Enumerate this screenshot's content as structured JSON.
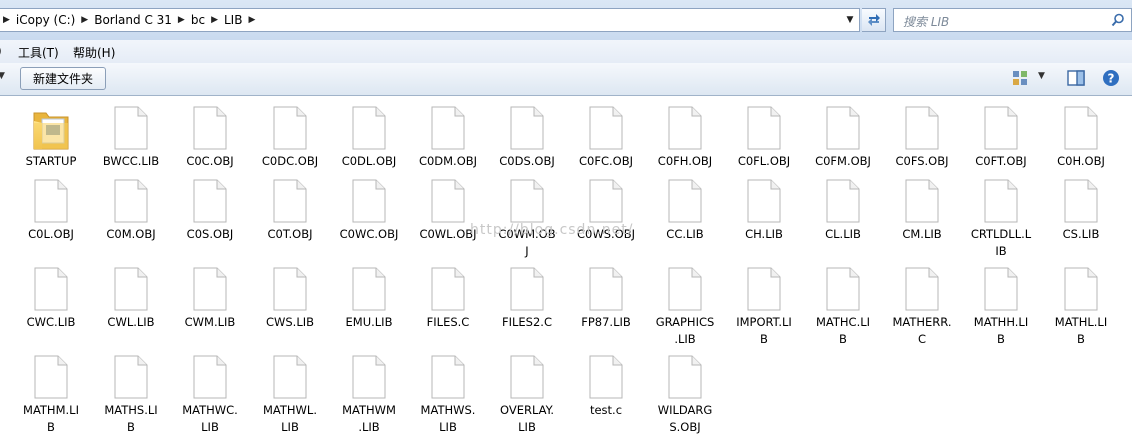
{
  "address": {
    "crumbs": [
      "iCopy (C:)",
      "Borland C 31",
      "bc",
      "LIB"
    ]
  },
  "search": {
    "placeholder": "搜索 LIB"
  },
  "menu": {
    "tools": "工具(T)",
    "help": "帮助(H)"
  },
  "toolbar": {
    "new_folder": "新建文件夹"
  },
  "files": [
    {
      "type": "folder",
      "l1": "STARTUP",
      "l2": ""
    },
    {
      "type": "file",
      "l1": "BWCC.LIB",
      "l2": ""
    },
    {
      "type": "file",
      "l1": "C0C.OBJ",
      "l2": ""
    },
    {
      "type": "file",
      "l1": "C0DC.OBJ",
      "l2": ""
    },
    {
      "type": "file",
      "l1": "C0DL.OBJ",
      "l2": ""
    },
    {
      "type": "file",
      "l1": "C0DM.OBJ",
      "l2": ""
    },
    {
      "type": "file",
      "l1": "C0DS.OBJ",
      "l2": ""
    },
    {
      "type": "file",
      "l1": "C0FC.OBJ",
      "l2": ""
    },
    {
      "type": "file",
      "l1": "C0FH.OBJ",
      "l2": ""
    },
    {
      "type": "file",
      "l1": "C0FL.OBJ",
      "l2": ""
    },
    {
      "type": "file",
      "l1": "C0FM.OBJ",
      "l2": ""
    },
    {
      "type": "file",
      "l1": "C0FS.OBJ",
      "l2": ""
    },
    {
      "type": "file",
      "l1": "C0FT.OBJ",
      "l2": ""
    },
    {
      "type": "file",
      "l1": "C0H.OBJ",
      "l2": ""
    },
    {
      "type": "file",
      "l1": "C0L.OBJ",
      "l2": ""
    },
    {
      "type": "file",
      "l1": "C0M.OBJ",
      "l2": ""
    },
    {
      "type": "file",
      "l1": "C0S.OBJ",
      "l2": ""
    },
    {
      "type": "file",
      "l1": "C0T.OBJ",
      "l2": ""
    },
    {
      "type": "file",
      "l1": "C0WC.OBJ",
      "l2": ""
    },
    {
      "type": "file",
      "l1": "C0WL.OBJ",
      "l2": ""
    },
    {
      "type": "file",
      "l1": "C0WM.OB",
      "l2": "J"
    },
    {
      "type": "file",
      "l1": "C0WS.OBJ",
      "l2": ""
    },
    {
      "type": "file",
      "l1": "CC.LIB",
      "l2": ""
    },
    {
      "type": "file",
      "l1": "CH.LIB",
      "l2": ""
    },
    {
      "type": "file",
      "l1": "CL.LIB",
      "l2": ""
    },
    {
      "type": "file",
      "l1": "CM.LIB",
      "l2": ""
    },
    {
      "type": "file",
      "l1": "CRTLDLL.L",
      "l2": "IB"
    },
    {
      "type": "file",
      "l1": "CS.LIB",
      "l2": ""
    },
    {
      "type": "file",
      "l1": "CWC.LIB",
      "l2": ""
    },
    {
      "type": "file",
      "l1": "CWL.LIB",
      "l2": ""
    },
    {
      "type": "file",
      "l1": "CWM.LIB",
      "l2": ""
    },
    {
      "type": "file",
      "l1": "CWS.LIB",
      "l2": ""
    },
    {
      "type": "file",
      "l1": "EMU.LIB",
      "l2": ""
    },
    {
      "type": "file",
      "l1": "FILES.C",
      "l2": ""
    },
    {
      "type": "file",
      "l1": "FILES2.C",
      "l2": ""
    },
    {
      "type": "file",
      "l1": "FP87.LIB",
      "l2": ""
    },
    {
      "type": "file",
      "l1": "GRAPHICS",
      "l2": ".LIB"
    },
    {
      "type": "file",
      "l1": "IMPORT.LI",
      "l2": "B"
    },
    {
      "type": "file",
      "l1": "MATHC.LI",
      "l2": "B"
    },
    {
      "type": "file",
      "l1": "MATHERR.",
      "l2": "C"
    },
    {
      "type": "file",
      "l1": "MATHH.LI",
      "l2": "B"
    },
    {
      "type": "file",
      "l1": "MATHL.LI",
      "l2": "B"
    },
    {
      "type": "file",
      "l1": "MATHM.LI",
      "l2": "B"
    },
    {
      "type": "file",
      "l1": "MATHS.LI",
      "l2": "B"
    },
    {
      "type": "file",
      "l1": "MATHWC.",
      "l2": "LIB"
    },
    {
      "type": "file",
      "l1": "MATHWL.",
      "l2": "LIB"
    },
    {
      "type": "file",
      "l1": "MATHWM",
      "l2": ".LIB"
    },
    {
      "type": "file",
      "l1": "MATHWS.",
      "l2": "LIB"
    },
    {
      "type": "file",
      "l1": "OVERLAY.",
      "l2": "LIB"
    },
    {
      "type": "file",
      "l1": "test.c",
      "l2": ""
    },
    {
      "type": "file",
      "l1": "WILDARG",
      "l2": "S.OBJ"
    }
  ]
}
